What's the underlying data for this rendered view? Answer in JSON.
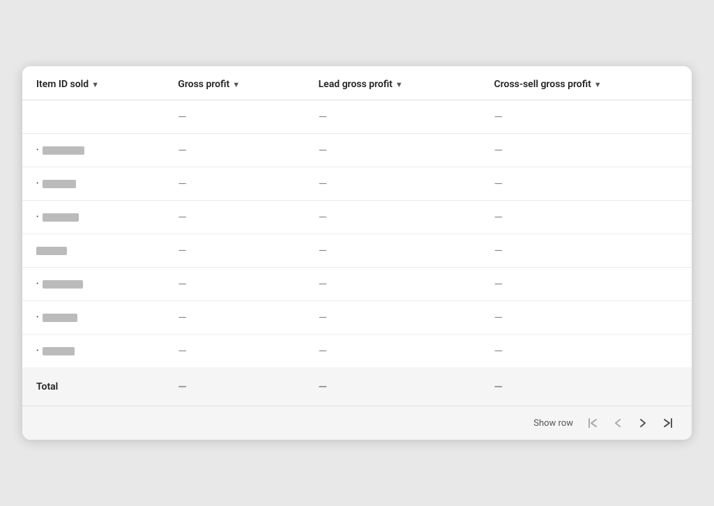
{
  "columns": [
    {
      "id": "item_id_sold",
      "label": "Item ID sold"
    },
    {
      "id": "gross_profit",
      "label": "Gross profit"
    },
    {
      "id": "lead_gross_profit",
      "label": "Lead gross profit"
    },
    {
      "id": "cross_sell_gross_profit",
      "label": "Cross-sell gross profit"
    }
  ],
  "rows": [
    {
      "item_id": "",
      "has_bullet": false,
      "redacted_width": 0,
      "gross_profit": "—",
      "lead_gross_profit": "—",
      "cross_sell": "—"
    },
    {
      "item_id": "",
      "has_bullet": true,
      "redacted_width": 60,
      "gross_profit": "—",
      "lead_gross_profit": "—",
      "cross_sell": "—"
    },
    {
      "item_id": "",
      "has_bullet": true,
      "redacted_width": 48,
      "gross_profit": "—",
      "lead_gross_profit": "—",
      "cross_sell": "—"
    },
    {
      "item_id": "",
      "has_bullet": true,
      "redacted_width": 52,
      "gross_profit": "—",
      "lead_gross_profit": "—",
      "cross_sell": "—"
    },
    {
      "item_id": "",
      "has_bullet": false,
      "redacted_width": 44,
      "gross_profit": "—",
      "lead_gross_profit": "—",
      "cross_sell": "—"
    },
    {
      "item_id": "",
      "has_bullet": true,
      "redacted_width": 58,
      "gross_profit": "—",
      "lead_gross_profit": "—",
      "cross_sell": "—"
    },
    {
      "item_id": "",
      "has_bullet": true,
      "redacted_width": 50,
      "gross_profit": "—",
      "lead_gross_profit": "—",
      "cross_sell": "—"
    },
    {
      "item_id": "",
      "has_bullet": true,
      "redacted_width": 46,
      "gross_profit": "—",
      "lead_gross_profit": "—",
      "cross_sell": "—"
    }
  ],
  "total_row": {
    "label": "Total",
    "gross_profit": "—",
    "lead_gross_profit": "—",
    "cross_sell": "—"
  },
  "footer": {
    "show_row_label": "Show row",
    "first_label": "⏮",
    "prev_label": "‹",
    "next_label": "›",
    "last_label": "⏭"
  }
}
